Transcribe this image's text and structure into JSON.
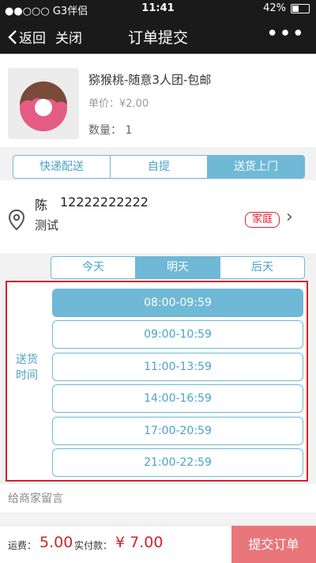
{
  "status_bar": {
    "carrier": "●●○○○ G3伴侣",
    "time": "11:41",
    "battery": "42%"
  },
  "nav": {
    "back_label": "返回",
    "close_label": "关闭",
    "title": "订单提交",
    "more_label": "•••"
  },
  "product": {
    "name": "猕猴桃-随意3人团-包邮",
    "price": "单价：¥2.00",
    "quantity": "数量： 1"
  },
  "delivery_methods": {
    "items": [
      "快递配送",
      "自提",
      "送货上门"
    ],
    "active_index": 2
  },
  "address": {
    "name": "陈",
    "phone": "12222222222",
    "detail": "测试",
    "tag": "家庭"
  },
  "days": {
    "items": [
      "今天",
      "明天",
      "后天"
    ],
    "active_index": 1
  },
  "time_section": {
    "label": "送货\n时间",
    "slots": [
      "08:00-09:59",
      "09:00-10:59",
      "11:00-13:59",
      "14:00-16:59",
      "17:00-20:59",
      "21:00-22:59"
    ],
    "active_index": 0
  },
  "remark": {
    "placeholder": "给商家留言"
  },
  "footer": {
    "shipping_label": "运费：",
    "shipping_value": "5.00",
    "total_label": "实付款：",
    "total_value": "¥ 7.00",
    "submit_label": "提交订单"
  },
  "colors": {
    "accent": "#6fb8d6",
    "highlight": "#d7212b",
    "submit": "#e8767b",
    "nav_bg": "#1a1a1a"
  }
}
